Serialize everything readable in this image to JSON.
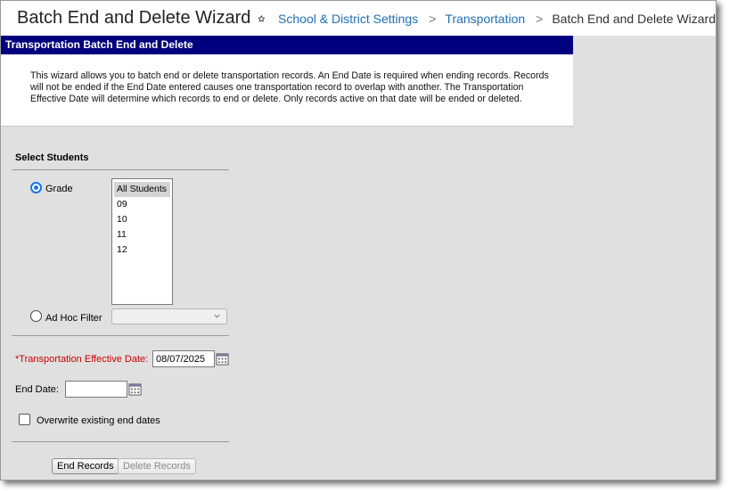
{
  "header": {
    "title": "Batch End and Delete Wizard",
    "breadcrumbs": [
      {
        "label": "School & District Settings"
      },
      {
        "label": "Transportation"
      },
      {
        "label": "Batch End and Delete Wizard"
      }
    ],
    "separator": ">"
  },
  "panel": {
    "title": "Transportation Batch End and Delete",
    "description": "This wizard allows you to batch end or delete transportation records. An End Date is required when ending records. Records will not be ended if the End Date entered causes one transportation record to overlap with another. The Transportation Effective Date will determine which records to end or delete. Only records active on that date will be ended or deleted."
  },
  "form": {
    "section_title": "Select Students",
    "grade_label": "Grade",
    "grade_selected": true,
    "grade_options": [
      {
        "label": "All Students",
        "selected": true
      },
      {
        "label": "09",
        "selected": false
      },
      {
        "label": "10",
        "selected": false
      },
      {
        "label": "11",
        "selected": false
      },
      {
        "label": "12",
        "selected": false
      }
    ],
    "adhoc_label": "Ad Hoc Filter",
    "adhoc_value": "",
    "effective_date_label": "*Transportation Effective Date:",
    "effective_date_value": "08/07/2025",
    "end_date_label": "End Date:",
    "end_date_value": "",
    "overwrite_label": "Overwrite existing end dates",
    "overwrite_checked": false
  },
  "buttons": {
    "end_records": "End Records",
    "delete_records": "Delete Records"
  },
  "colors": {
    "header_bar": "#00007e",
    "link": "#1f6fb2",
    "required_label": "#cc0000",
    "radio_accent": "#1a73e8",
    "background": "#e0e0e0"
  },
  "icons": [
    "star-icon",
    "chevron-down-icon",
    "calendar-icon"
  ]
}
